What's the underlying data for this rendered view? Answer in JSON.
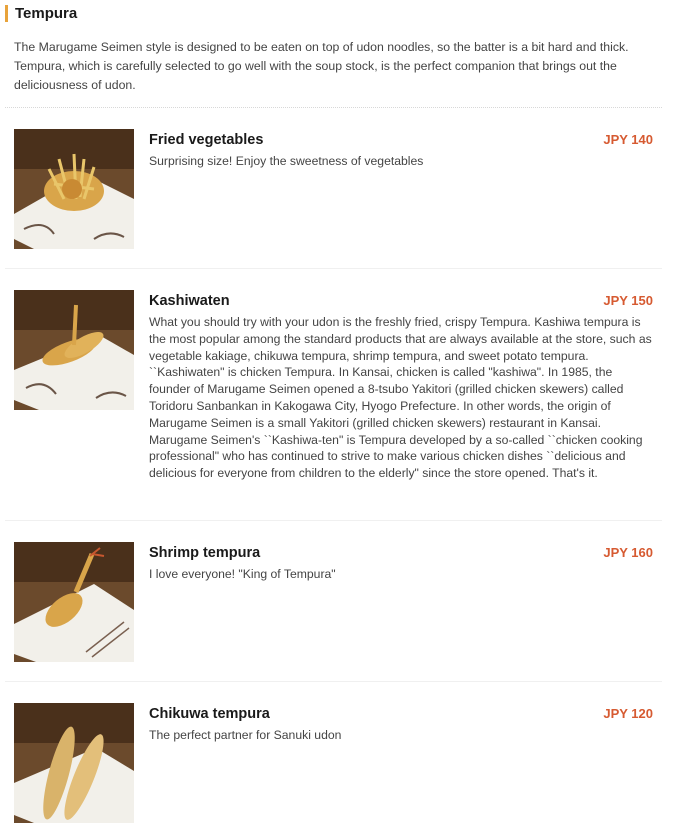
{
  "section": {
    "title": "Tempura",
    "intro": "The Marugame Seimen style is designed to be eaten on top of udon noodles, so the batter is a bit hard and thick. Tempura, which is carefully selected to go well with the soup stock, is the perfect companion that brings out the deliciousness of udon."
  },
  "colors": {
    "accent": "#e8a33b",
    "price": "#d65a31"
  },
  "items": [
    {
      "name": "Fried vegetables",
      "price": "JPY 140",
      "desc": "Surprising size! Enjoy the sweetness of vegetables"
    },
    {
      "name": "Kashiwaten",
      "price": "JPY 150",
      "desc": "What you should try with your udon is the freshly fried, crispy Tempura. Kashiwa tempura is the most popular among the standard products that are always available at the store, such as vegetable kakiage, chikuwa tempura, shrimp tempura, and sweet potato tempura. ``Kashiwaten\" is chicken Tempura. In Kansai, chicken is called \"kashiwa\". In 1985, the founder of Marugame Seimen opened a 8-tsubo Yakitori (grilled chicken skewers) called Toridoru Sanbankan in Kakogawa City, Hyogo Prefecture. In other words, the origin of Marugame Seimen is a small Yakitori (grilled chicken skewers) restaurant in Kansai. Marugame Seimen's ``Kashiwa-ten\" is Tempura developed by a so-called ``chicken cooking professional\" who has continued to strive to make various chicken dishes ``delicious and delicious for everyone from children to the elderly\" since the store opened. That's it."
    },
    {
      "name": "Shrimp tempura",
      "price": "JPY 160",
      "desc": "I love everyone! \"King of Tempura\""
    },
    {
      "name": "Chikuwa tempura",
      "price": "JPY 120",
      "desc": "The perfect partner for Sanuki udon"
    }
  ]
}
